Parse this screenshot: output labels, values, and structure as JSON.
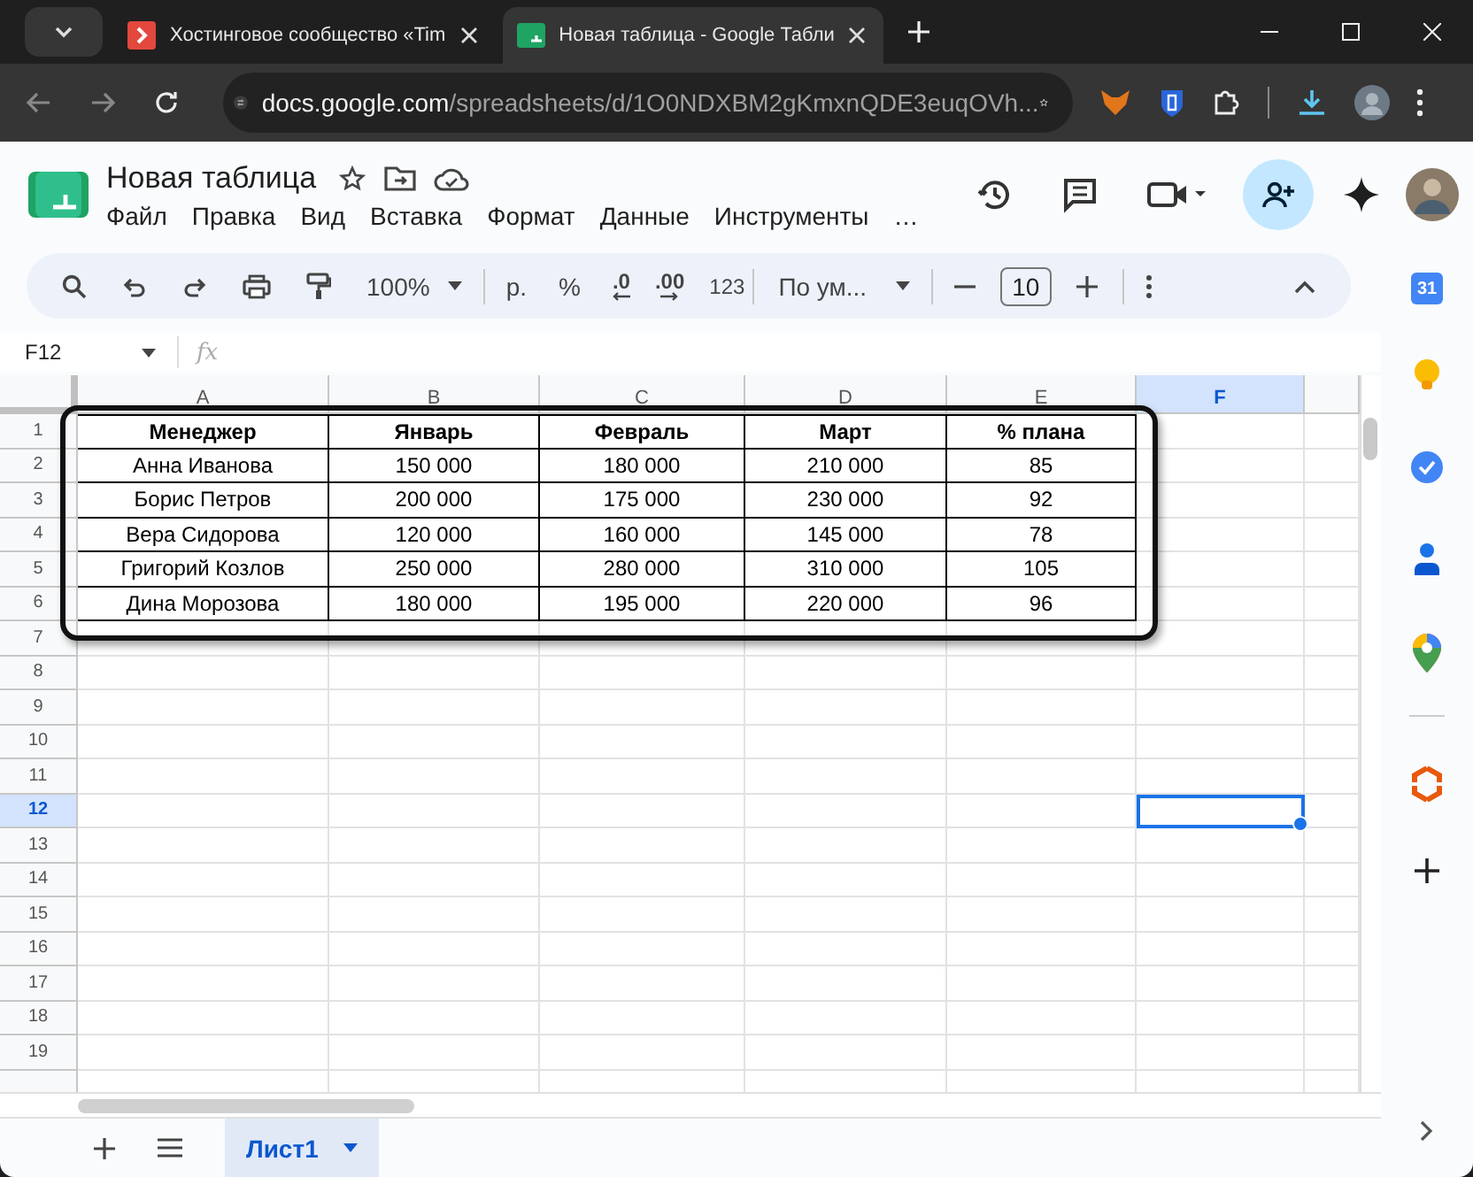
{
  "browser": {
    "tabs": [
      {
        "title": "Хостинговое сообщество «Tim",
        "selected": false
      },
      {
        "title": "Новая таблица - Google Табли",
        "selected": true
      }
    ],
    "url_host": "docs.google.com",
    "url_path": "/spreadsheets/d/1O0NDXBM2gKmxnQDE3euqOVh..."
  },
  "doc": {
    "title": "Новая таблица",
    "menu": [
      "Файл",
      "Правка",
      "Вид",
      "Вставка",
      "Формат",
      "Данные",
      "Инструменты"
    ],
    "menu_more": "…"
  },
  "toolbar": {
    "zoom": "100%",
    "currency": "р.",
    "percent": "%",
    "decrease_decimals": ".0",
    "increase_decimals": ".00",
    "number_format": "123",
    "font": "По ум...",
    "font_size": "10"
  },
  "formula_bar": {
    "cell": "F12",
    "fx": "fx"
  },
  "columns": [
    {
      "label": "A",
      "selected": false
    },
    {
      "label": "B",
      "selected": false
    },
    {
      "label": "C",
      "selected": false
    },
    {
      "label": "D",
      "selected": false
    },
    {
      "label": "E",
      "selected": false
    },
    {
      "label": "F",
      "selected": true
    }
  ],
  "rows": [
    {
      "label": "1",
      "selected": false
    },
    {
      "label": "2",
      "selected": false
    },
    {
      "label": "3",
      "selected": false
    },
    {
      "label": "4",
      "selected": false
    },
    {
      "label": "5",
      "selected": false
    },
    {
      "label": "6",
      "selected": false
    },
    {
      "label": "7",
      "selected": false
    },
    {
      "label": "8",
      "selected": false
    },
    {
      "label": "9",
      "selected": false
    },
    {
      "label": "10",
      "selected": false
    },
    {
      "label": "11",
      "selected": false
    },
    {
      "label": "12",
      "selected": true
    },
    {
      "label": "13",
      "selected": false
    },
    {
      "label": "14",
      "selected": false
    },
    {
      "label": "15",
      "selected": false
    },
    {
      "label": "16",
      "selected": false
    },
    {
      "label": "17",
      "selected": false
    },
    {
      "label": "18",
      "selected": false
    },
    {
      "label": "19",
      "selected": false
    }
  ],
  "table": {
    "header": [
      "Менеджер",
      "Январь",
      "Февраль",
      "Март",
      "% плана"
    ],
    "rows": [
      [
        "Анна Иванова",
        "150 000",
        "180 000",
        "210 000",
        "85"
      ],
      [
        "Борис Петров",
        "200 000",
        "175 000",
        "230 000",
        "92"
      ],
      [
        "Вера Сидорова",
        "120 000",
        "160 000",
        "145 000",
        "78"
      ],
      [
        "Григорий Козлов",
        "250 000",
        "280 000",
        "310 000",
        "105"
      ],
      [
        "Дина Морозова",
        "180 000",
        "195 000",
        "220 000",
        "96"
      ]
    ]
  },
  "side_panel": {
    "calendar_day": "31"
  },
  "sheets": [
    {
      "label": "Лист1",
      "selected": true
    }
  ]
}
